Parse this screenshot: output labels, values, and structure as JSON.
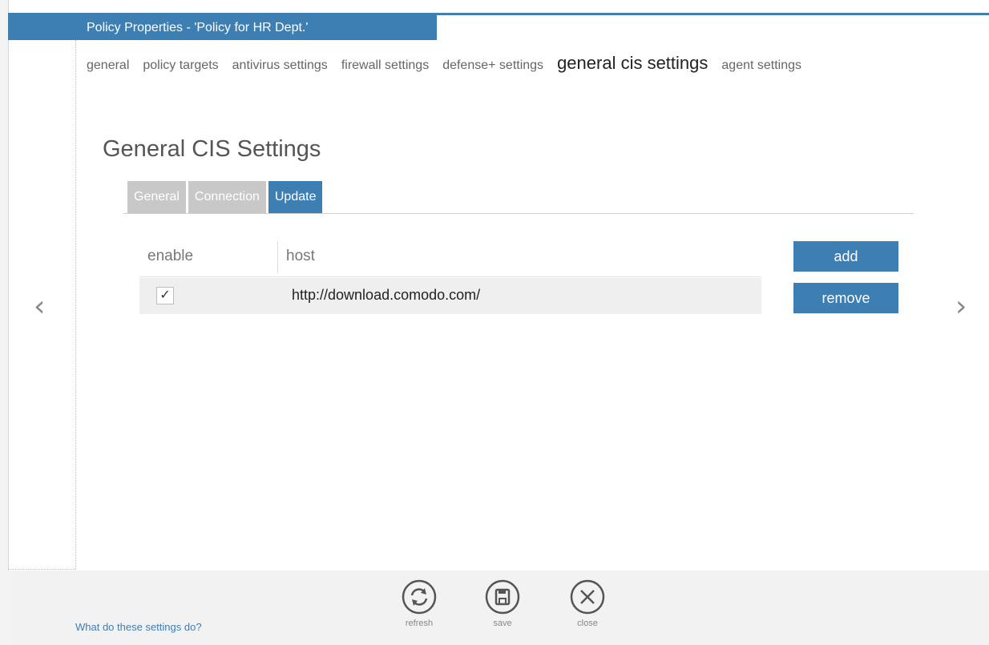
{
  "colors": {
    "accent": "#3d7fb3",
    "tab_inactive": "#c8c8c8",
    "footer_bg": "#f2f2f2"
  },
  "window": {
    "title": "Policy Properties - 'Policy for HR Dept.'"
  },
  "nav": {
    "items": [
      {
        "label": "general"
      },
      {
        "label": "policy targets"
      },
      {
        "label": "antivirus settings"
      },
      {
        "label": "firewall settings"
      },
      {
        "label": "defense+ settings"
      },
      {
        "label": "general cis settings",
        "active": true
      },
      {
        "label": "agent settings"
      }
    ]
  },
  "page": {
    "title": "General CIS Settings"
  },
  "subtabs": [
    {
      "label": "General"
    },
    {
      "label": "Connection"
    },
    {
      "label": "Update",
      "active": true
    }
  ],
  "table": {
    "columns": [
      "enable",
      "host"
    ],
    "rows": [
      {
        "enabled": true,
        "check_glyph": "✓",
        "host": "http://download.comodo.com/"
      }
    ]
  },
  "buttons": {
    "add": "add",
    "remove": "remove"
  },
  "arrows": {
    "prev": "‹",
    "next": "›"
  },
  "footer": {
    "help": "What do these settings do?",
    "refresh": "refresh",
    "save": "save",
    "close": "close"
  },
  "icons": {
    "refresh": "refresh-icon",
    "save": "save-icon",
    "close": "close-icon",
    "prev": "chevron-left-icon",
    "next": "chevron-right-icon",
    "check": "checkmark-icon"
  }
}
